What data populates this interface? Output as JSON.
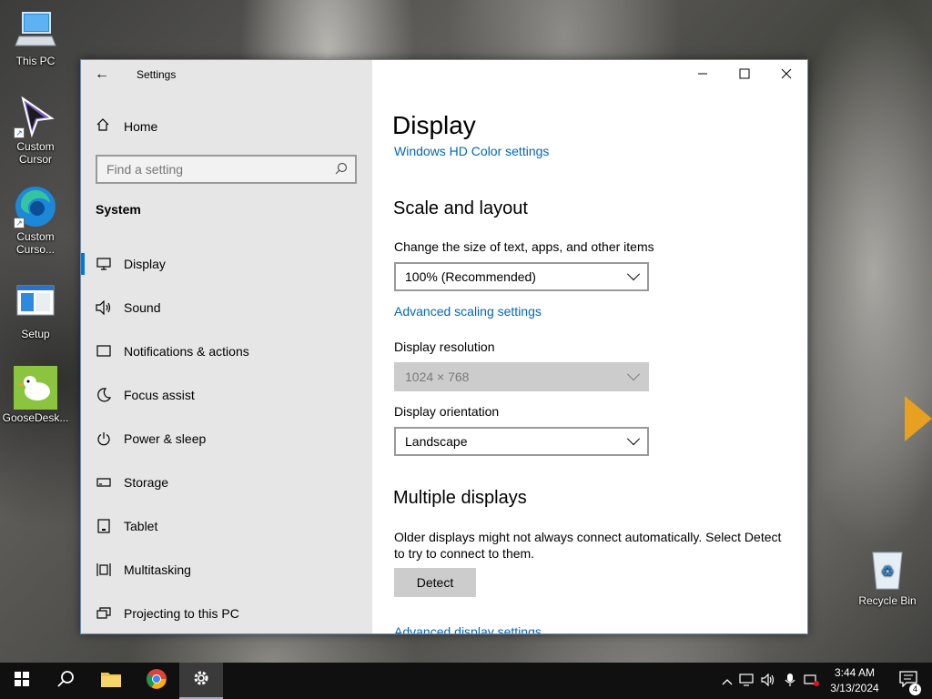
{
  "desktop": {
    "icons": [
      {
        "label": "This PC"
      },
      {
        "label": "Custom Cursor"
      },
      {
        "label": "Custom Curso..."
      },
      {
        "label": "Setup"
      },
      {
        "label": "GooseDesk..."
      },
      {
        "label": "Recycle Bin"
      }
    ]
  },
  "window": {
    "app_title": "Settings",
    "sidebar": {
      "home_label": "Home",
      "search_placeholder": "Find a setting",
      "section_header": "System",
      "items": [
        {
          "label": "Display",
          "icon": "monitor-icon",
          "active": true
        },
        {
          "label": "Sound",
          "icon": "speaker-icon"
        },
        {
          "label": "Notifications & actions",
          "icon": "notification-icon"
        },
        {
          "label": "Focus assist",
          "icon": "moon-icon"
        },
        {
          "label": "Power & sleep",
          "icon": "power-icon"
        },
        {
          "label": "Storage",
          "icon": "storage-icon"
        },
        {
          "label": "Tablet",
          "icon": "tablet-icon"
        },
        {
          "label": "Multitasking",
          "icon": "multitasking-icon"
        },
        {
          "label": "Projecting to this PC",
          "icon": "projecting-icon"
        }
      ]
    },
    "main": {
      "title": "Display",
      "hd_color_link": "Windows HD Color settings",
      "scale_heading": "Scale and layout",
      "scale_label": "Change the size of text, apps, and other items",
      "scale_value": "100% (Recommended)",
      "advanced_scaling_link": "Advanced scaling settings",
      "resolution_label": "Display resolution",
      "resolution_value": "1024 × 768",
      "orientation_label": "Display orientation",
      "orientation_value": "Landscape",
      "multiple_heading": "Multiple displays",
      "multiple_desc_1": "Older displays might not always connect automatically. Select Detect",
      "multiple_desc_2": "to try to connect to them.",
      "detect_label": "Detect",
      "advanced_display_link": "Advanced display settings"
    }
  },
  "taskbar": {
    "time": "3:44 AM",
    "date": "3/13/2024",
    "notification_count": "4"
  },
  "colors": {
    "accent": "#0078d7",
    "link": "#0067b8",
    "sidebar_bg": "#e6e6e6",
    "taskbar_bg": "#101010"
  }
}
